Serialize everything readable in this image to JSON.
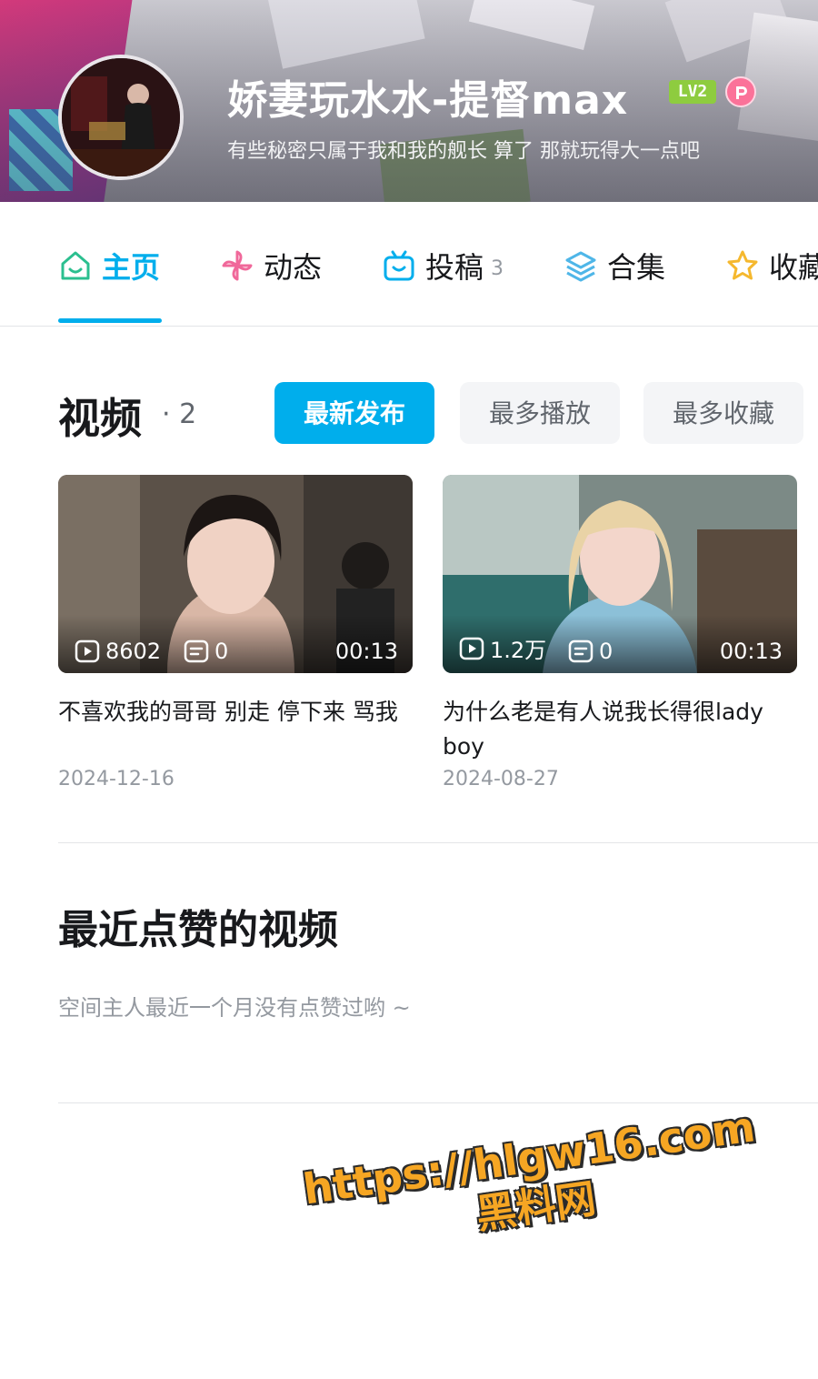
{
  "profile": {
    "username": "娇妻玩水水-提督max",
    "level": "LV2",
    "signature": "有些秘密只属于我和我的舰长 算了 那就玩得大一点吧"
  },
  "tabs": [
    {
      "label": "主页",
      "icon": "home-icon",
      "active": true
    },
    {
      "label": "动态",
      "icon": "windmill-icon"
    },
    {
      "label": "投稿",
      "icon": "tv-icon",
      "count": "3"
    },
    {
      "label": "合集",
      "icon": "layers-icon"
    },
    {
      "label": "收藏",
      "icon": "star-icon"
    }
  ],
  "videos": {
    "heading": "视频",
    "count_text": "· 2",
    "sort_options": [
      "最新发布",
      "最多播放",
      "最多收藏"
    ],
    "selected_sort": "最新发布",
    "items": [
      {
        "plays": "8602",
        "danmaku": "0",
        "duration": "00:13",
        "title": "不喜欢我的哥哥 别走 停下来 骂我",
        "date": "2024-12-16"
      },
      {
        "plays": "1.2万",
        "danmaku": "0",
        "duration": "00:13",
        "title": "为什么老是有人说我长得很lady boy",
        "date": "2024-08-27"
      }
    ]
  },
  "liked": {
    "heading": "最近点赞的视频",
    "empty_text": "空间主人最近一个月没有点赞过哟 ~"
  },
  "watermark": {
    "url": "https://hlgw16.com",
    "name": "黑料网"
  },
  "colors": {
    "accent": "#00aeec",
    "level_badge": "#8ecc3f",
    "vip_pink": "#fb7299",
    "watermark": "#f6a623"
  }
}
